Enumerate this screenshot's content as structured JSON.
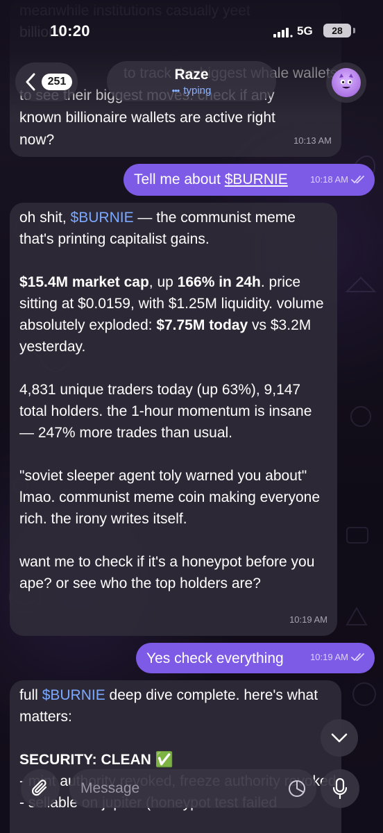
{
  "status_bar": {
    "time": "10:20",
    "network": "5G",
    "battery": "28"
  },
  "header": {
    "back_count": "251",
    "chat_name": "Raze",
    "chat_status": "typing"
  },
  "messages": {
    "m0": {
      "line_a": "meanwhile institutions casually yeet",
      "line_b": "billions",
      "line_c": "to track the biggest whale wallets",
      "line_d": "to see their biggest moves. check if any",
      "line_e": "known billionaire wallets are active right",
      "line_f": "now?",
      "time": "10:13 AM"
    },
    "m1": {
      "text_before": "Tell me about ",
      "ticker": "$BURNIE",
      "time": "10:18 AM"
    },
    "m2": {
      "p1_a": "oh shit, ",
      "p1_ticker": "$BURNIE",
      "p1_b": " — the communist meme that's printing capitalist gains.",
      "p2_bold_a": "$15.4M market cap",
      "p2_a": ", up ",
      "p2_bold_b": "166% in 24h",
      "p2_b": ". price sitting at $0.0159, with $1.25M liquidity. volume absolutely exploded: ",
      "p2_bold_c": "$7.75M today",
      "p2_c": " vs $3.2M yesterday.",
      "p3": "4,831 unique traders today (up 63%), 9,147 total holders. the 1-hour momentum is insane — 247% more trades than usual.",
      "p4": "\"soviet sleeper agent toly warned you about\" lmao. communist meme coin making everyone rich. the irony writes itself.",
      "p5": "want me to check if it's a honeypot before you ape? or see who the top holders are?",
      "time": "10:19 AM"
    },
    "m3": {
      "text": "Yes check everything",
      "time": "10:19 AM"
    },
    "m4": {
      "p1_a": "full ",
      "p1_ticker": "$BURNIE",
      "p1_b": " deep dive complete. here's what matters:",
      "p2": "SECURITY: CLEAN ✅",
      "p3": "- mint authority revoked, freeze authority revoked",
      "p4": "- sellable on jupiter (honeypot test failed"
    }
  },
  "input": {
    "placeholder": "Message"
  },
  "colors": {
    "accent_bubble": "#7d5be6",
    "link": "#7aa9ff",
    "typing": "#8ab2ff"
  },
  "icons": {
    "back": "chevron-left-icon",
    "avatar": "purple-monster-avatar",
    "scroll": "chevron-down-icon",
    "attach": "paperclip-icon",
    "sticker": "sticker-icon",
    "mic": "microphone-icon",
    "read": "double-check-icon"
  }
}
